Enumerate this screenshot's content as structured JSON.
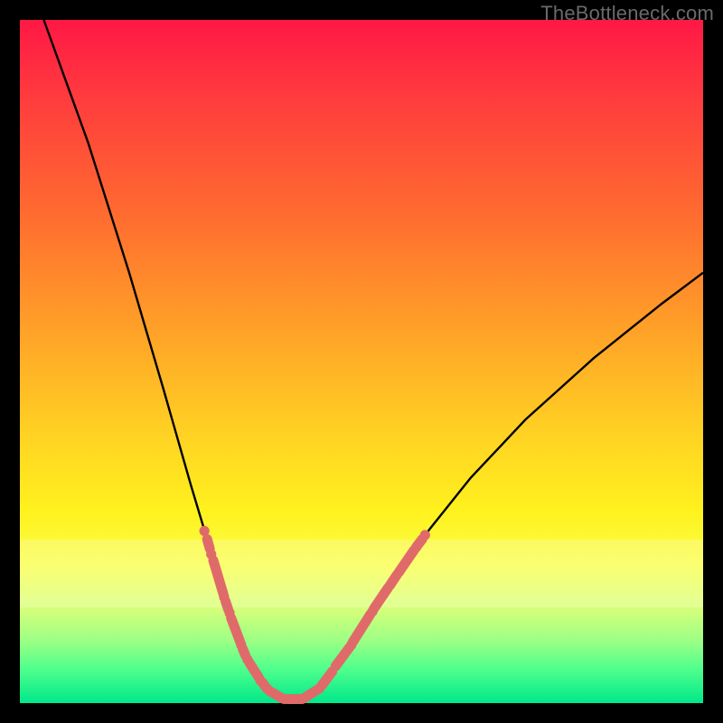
{
  "watermark": "TheBottleneck.com",
  "colors": {
    "frame": "#000000",
    "curve": "#000000",
    "marker_fill": "#e06a6a",
    "marker_stroke": "#d65a5a",
    "gradient_top": "#ff1845",
    "gradient_bottom": "#00e88a"
  },
  "chart_data": {
    "type": "line",
    "title": "",
    "xlabel": "",
    "ylabel": "",
    "xlim": [
      0,
      100
    ],
    "ylim": [
      0,
      100
    ],
    "pale_band_y": [
      14,
      24
    ],
    "curve_points": [
      {
        "x": 3.5,
        "y": 100.0
      },
      {
        "x": 10.0,
        "y": 82.0
      },
      {
        "x": 16.0,
        "y": 63.0
      },
      {
        "x": 21.0,
        "y": 46.0
      },
      {
        "x": 25.0,
        "y": 32.0
      },
      {
        "x": 28.0,
        "y": 22.0
      },
      {
        "x": 30.5,
        "y": 14.0
      },
      {
        "x": 33.0,
        "y": 7.5
      },
      {
        "x": 35.0,
        "y": 3.8
      },
      {
        "x": 37.0,
        "y": 1.6
      },
      {
        "x": 39.0,
        "y": 0.6
      },
      {
        "x": 41.0,
        "y": 0.6
      },
      {
        "x": 43.0,
        "y": 1.6
      },
      {
        "x": 45.0,
        "y": 3.6
      },
      {
        "x": 48.0,
        "y": 7.8
      },
      {
        "x": 51.0,
        "y": 12.5
      },
      {
        "x": 55.0,
        "y": 18.5
      },
      {
        "x": 60.0,
        "y": 25.5
      },
      {
        "x": 66.0,
        "y": 33.0
      },
      {
        "x": 74.0,
        "y": 41.5
      },
      {
        "x": 84.0,
        "y": 50.5
      },
      {
        "x": 94.0,
        "y": 58.5
      },
      {
        "x": 100.0,
        "y": 63.0
      }
    ],
    "marker_segments_left": [
      {
        "x1": 27.4,
        "y1": 24.0,
        "x2": 27.8,
        "y2": 22.6
      },
      {
        "x1": 28.3,
        "y1": 20.9,
        "x2": 29.8,
        "y2": 15.9
      },
      {
        "x1": 30.1,
        "y1": 14.9,
        "x2": 30.5,
        "y2": 13.7
      },
      {
        "x1": 30.9,
        "y1": 12.5,
        "x2": 32.3,
        "y2": 8.8
      },
      {
        "x1": 32.6,
        "y1": 8.0,
        "x2": 33.0,
        "y2": 7.0
      }
    ],
    "marker_segments_right": [
      {
        "x1": 46.2,
        "y1": 5.4,
        "x2": 48.2,
        "y2": 8.1
      },
      {
        "x1": 48.7,
        "y1": 8.9,
        "x2": 51.3,
        "y2": 13.0
      },
      {
        "x1": 51.8,
        "y1": 13.8,
        "x2": 53.9,
        "y2": 16.9
      },
      {
        "x1": 54.4,
        "y1": 17.6,
        "x2": 55.2,
        "y2": 18.8
      },
      {
        "x1": 55.7,
        "y1": 19.5,
        "x2": 57.7,
        "y2": 22.4
      },
      {
        "x1": 58.2,
        "y1": 23.1,
        "x2": 58.9,
        "y2": 24.0
      }
    ],
    "marker_segments_bottom": [
      {
        "x1": 33.6,
        "y1": 5.9,
        "x2": 35.0,
        "y2": 3.7
      },
      {
        "x1": 35.5,
        "y1": 3.0,
        "x2": 36.0,
        "y2": 2.3
      },
      {
        "x1": 36.5,
        "y1": 1.8,
        "x2": 38.4,
        "y2": 0.7
      },
      {
        "x1": 39.1,
        "y1": 0.6,
        "x2": 41.0,
        "y2": 0.6
      },
      {
        "x1": 41.7,
        "y1": 0.8,
        "x2": 43.6,
        "y2": 2.0
      },
      {
        "x1": 44.2,
        "y1": 2.6,
        "x2": 45.4,
        "y2": 4.2
      }
    ],
    "marker_dots": [
      {
        "x": 27.0,
        "y": 25.2
      },
      {
        "x": 28.0,
        "y": 21.8
      },
      {
        "x": 29.9,
        "y": 15.5
      },
      {
        "x": 30.7,
        "y": 13.2
      },
      {
        "x": 32.4,
        "y": 8.5
      },
      {
        "x": 33.3,
        "y": 6.4
      },
      {
        "x": 35.2,
        "y": 3.3
      },
      {
        "x": 36.2,
        "y": 2.1
      },
      {
        "x": 38.7,
        "y": 0.6
      },
      {
        "x": 41.3,
        "y": 0.6
      },
      {
        "x": 43.9,
        "y": 2.2
      },
      {
        "x": 45.7,
        "y": 4.6
      },
      {
        "x": 48.5,
        "y": 8.5
      },
      {
        "x": 51.6,
        "y": 13.4
      },
      {
        "x": 54.2,
        "y": 17.3
      },
      {
        "x": 55.5,
        "y": 19.2
      },
      {
        "x": 58.0,
        "y": 22.8
      },
      {
        "x": 59.3,
        "y": 24.6
      }
    ]
  }
}
